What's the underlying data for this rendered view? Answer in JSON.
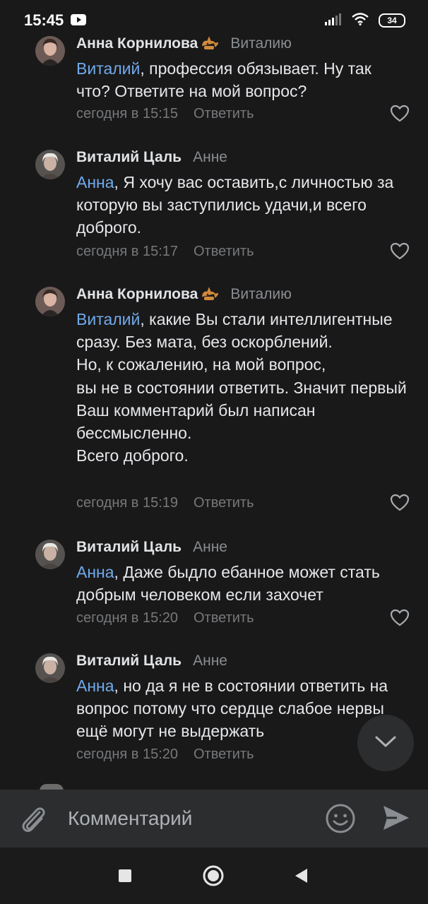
{
  "status_bar": {
    "time": "15:45",
    "battery": "34"
  },
  "comments": [
    {
      "author": "Анна Корнилова",
      "author_icon": "cat-emoji-icon",
      "reply_to": "Виталию",
      "mention": "Виталий",
      "text": ", профессия обязывает. Ну так что? Ответите на мой вопрос?",
      "time": "сегодня в 15:15",
      "reply_label": "Ответить"
    },
    {
      "author": "Виталий Цаль",
      "reply_to": "Анне",
      "mention": "Анна",
      "text": ", Я хочу вас оставить,с личностью за которую вы заступились удачи,и всего доброго.",
      "time": "сегодня в 15:17",
      "reply_label": "Ответить"
    },
    {
      "author": "Анна Корнилова",
      "author_icon": "cat-emoji-icon",
      "reply_to": "Виталию",
      "mention": "Виталий",
      "text": ", какие Вы стали интеллигентные сразу. Без мата, без оскорблений.\nНо, к сожалению, на мой вопрос,\nвы не в состоянии ответить. Значит первый Ваш комментарий был написан бессмысленно.\nВсего доброго.",
      "time": "сегодня в 15:19",
      "reply_label": "Ответить"
    },
    {
      "author": "Виталий Цаль",
      "reply_to": "Анне",
      "mention": "Анна",
      "text": ", Даже быдло ебанное может стать добрым человеком если захочет",
      "time": "сегодня в 15:20",
      "reply_label": "Ответить"
    },
    {
      "author": "Виталий Цаль",
      "reply_to": "Анне",
      "mention": "Анна",
      "text": ", но да я не в состоянии ответить на вопрос потому что сердце слабое нервы ещё могут не выдержать",
      "time": "сегодня в 15:20",
      "reply_label": "Ответить"
    }
  ],
  "composer": {
    "placeholder": "Комментарий"
  },
  "colors": {
    "background": "#19191a",
    "mention": "#71aaeb",
    "meta": "#76787a",
    "composer_bg": "#2c2d2e"
  }
}
